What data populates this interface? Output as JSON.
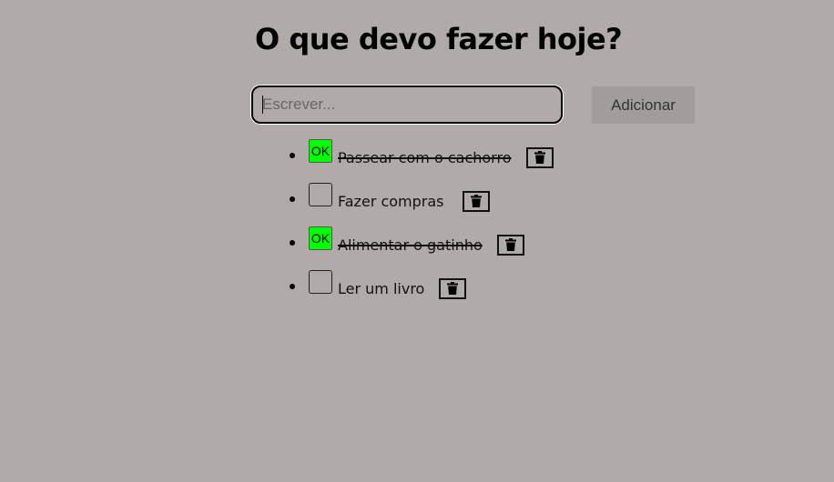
{
  "title": "O que devo fazer hoje?",
  "input": {
    "placeholder": "Escrever...",
    "value": ""
  },
  "add_button_label": "Adicionar",
  "tasks": [
    {
      "text": "Passear com o cachorro",
      "done": true,
      "check_label": "OK"
    },
    {
      "text": "Fazer compras",
      "done": false,
      "check_label": ""
    },
    {
      "text": "Alimentar o gatinho",
      "done": true,
      "check_label": "OK"
    },
    {
      "text": "Ler um livro",
      "done": false,
      "check_label": ""
    }
  ],
  "icons": {
    "delete": "trash-icon"
  },
  "colors": {
    "background": "#b0aaa9",
    "done_check": "#00ff00",
    "add_button_bg": "#a29d9c"
  }
}
